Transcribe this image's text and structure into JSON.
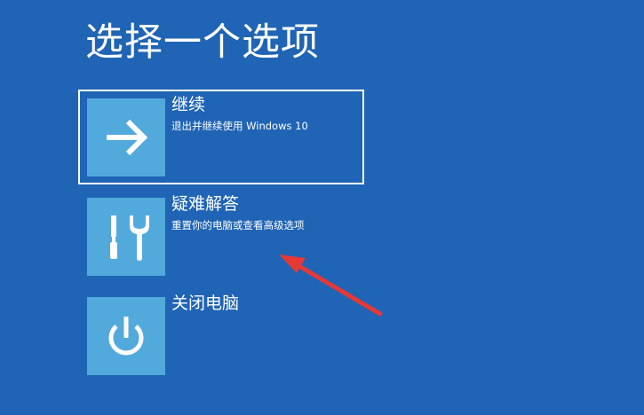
{
  "page": {
    "title": "选择一个选项"
  },
  "options": [
    {
      "label": "继续",
      "description": "退出并继续使用 Windows 10",
      "icon": "arrow-right-icon",
      "selected": true
    },
    {
      "label": "疑难解答",
      "description": "重置你的电脑或查看高级选项",
      "icon": "tools-icon",
      "selected": false
    },
    {
      "label": "关闭电脑",
      "description": "",
      "icon": "power-icon",
      "selected": false
    }
  ],
  "annotation": {
    "icon": "red-arrow-annotation",
    "color": "#e53935"
  },
  "colors": {
    "background": "#1f64b5",
    "tile": "#52a9dc",
    "text": "#ffffff"
  }
}
